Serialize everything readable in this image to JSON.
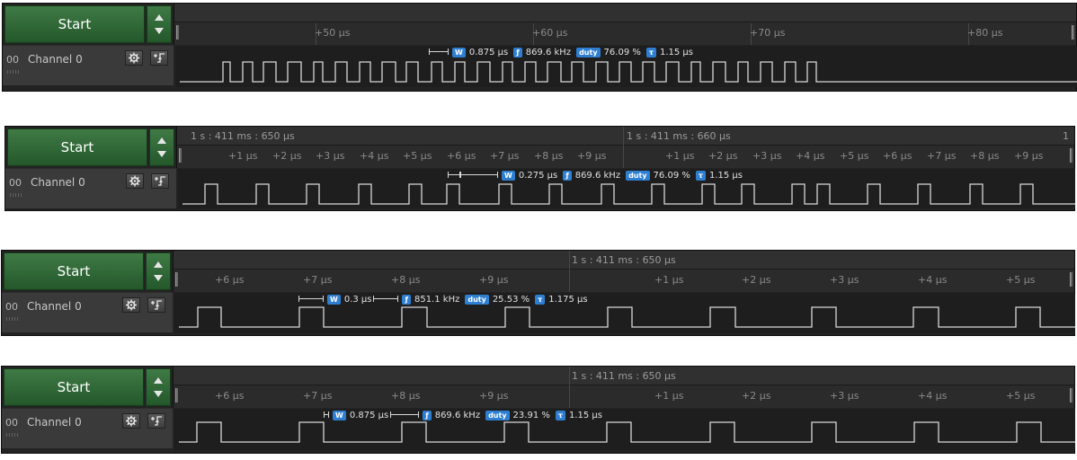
{
  "panels": [
    {
      "start_label": "Start",
      "absolute_labels": [],
      "tick_labels": [
        "+50 µs",
        "+60 µs",
        "+70 µs",
        "+80 µs"
      ],
      "channel": {
        "number": "00",
        "name": "Channel 0"
      },
      "measurement": {
        "width_badge": "W",
        "width": "0.875 µs",
        "freq_badge": "ƒ",
        "freq": "869.6 kHz",
        "duty_badge": "duty",
        "duty": "76.09 %",
        "period_badge": "τ",
        "period": "1.15 µs"
      }
    },
    {
      "start_label": "Start",
      "absolute_labels": [
        "1 s : 411 ms : 650 µs",
        "1 s : 411 ms : 660 µs",
        "1"
      ],
      "tick_labels": [
        "+1 µs",
        "+2 µs",
        "+3 µs",
        "+4 µs",
        "+5 µs",
        "+6 µs",
        "+7 µs",
        "+8 µs",
        "+9 µs",
        "+1 µs",
        "+2 µs",
        "+3 µs",
        "+4 µs",
        "+5 µs",
        "+6 µs",
        "+7 µs",
        "+8 µs",
        "+9 µs"
      ],
      "channel": {
        "number": "00",
        "name": "Channel 0"
      },
      "measurement": {
        "width_badge": "W",
        "width": "0.275 µs",
        "freq_badge": "ƒ",
        "freq": "869.6 kHz",
        "duty_badge": "duty",
        "duty": "76.09 %",
        "period_badge": "τ",
        "period": "1.15 µs"
      }
    },
    {
      "start_label": "Start",
      "absolute_labels": [
        "1 s : 411 ms : 650 µs"
      ],
      "tick_labels": [
        "+6 µs",
        "+7 µs",
        "+8 µs",
        "+9 µs",
        "+1 µs",
        "+2 µs",
        "+3 µs",
        "+4 µs",
        "+5 µs"
      ],
      "channel": {
        "number": "00",
        "name": "Channel 0"
      },
      "measurement": {
        "width_badge": "W",
        "width": "0.3 µs",
        "freq_badge": "ƒ",
        "freq": "851.1 kHz",
        "duty_badge": "duty",
        "duty": "25.53 %",
        "period_badge": "τ",
        "period": "1.175 µs"
      }
    },
    {
      "start_label": "Start",
      "absolute_labels": [
        "1 s : 411 ms : 650 µs"
      ],
      "tick_labels": [
        "+6 µs",
        "+7 µs",
        "+8 µs",
        "+9 µs",
        "+1 µs",
        "+2 µs",
        "+3 µs",
        "+4 µs",
        "+5 µs"
      ],
      "channel": {
        "number": "00",
        "name": "Channel 0"
      },
      "measurement": {
        "width_badge": "W",
        "width": "0.875 µs",
        "freq_badge": "ƒ",
        "freq": "869.6 kHz",
        "duty_badge": "duty",
        "duty": "23.91 %",
        "period_badge": "τ",
        "period": "1.15 µs"
      }
    }
  ],
  "colors": {
    "background": "#232323",
    "start_green": "#2f6b36",
    "signal": "#d8d8d8",
    "badge_blue": "#2e7fd1"
  },
  "icons": {
    "settings": "gear-icon",
    "trigger": "trigger-edge-icon",
    "scroll": "up-down-arrows-icon"
  }
}
